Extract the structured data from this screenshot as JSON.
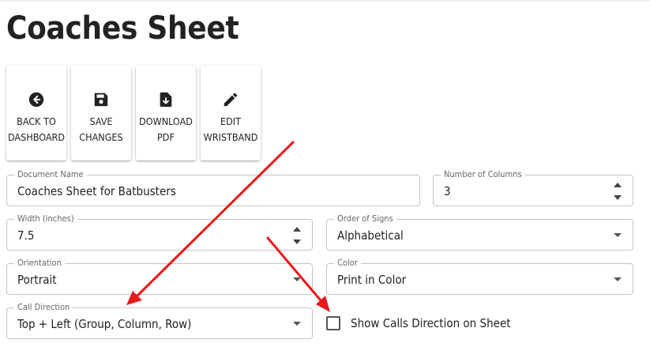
{
  "page": {
    "title": "Coaches Sheet"
  },
  "toolbar": {
    "buttons": [
      {
        "label": "BACK TO DASHBOARD",
        "icon": "arrow-left-circle-icon"
      },
      {
        "label": "SAVE CHANGES",
        "icon": "save-icon"
      },
      {
        "label": "DOWNLOAD PDF",
        "icon": "file-download-icon"
      },
      {
        "label": "EDIT WRISTBAND",
        "icon": "pencil-icon"
      }
    ]
  },
  "form": {
    "document_name": {
      "label": "Document Name",
      "value": "Coaches Sheet for Batbusters"
    },
    "number_of_columns": {
      "label": "Number of Columns",
      "value": "3"
    },
    "width": {
      "label": "Width (inches)",
      "value": "7.5"
    },
    "order_of_signs": {
      "label": "Order of Signs",
      "value": "Alphabetical"
    },
    "orientation": {
      "label": "Orientation",
      "value": "Portrait"
    },
    "color": {
      "label": "Color",
      "value": "Print in Color"
    },
    "call_direction": {
      "label": "Call Direction",
      "value": "Top + Left (Group, Column, Row)"
    },
    "show_calls_direction": {
      "label": "Show Calls Direction on Sheet",
      "checked": false
    }
  },
  "annotations": {
    "arrow_color": "#e8181c"
  }
}
